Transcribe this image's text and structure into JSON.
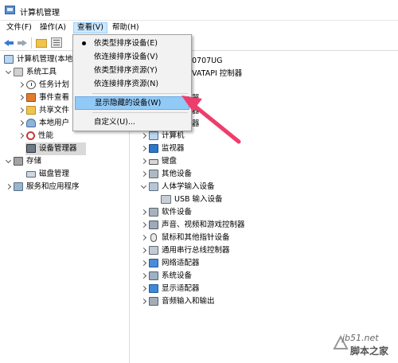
{
  "window": {
    "title": "计算机管理"
  },
  "menubar": [
    {
      "label": "文件(F)"
    },
    {
      "label": "操作(A)"
    },
    {
      "label": "查看(V)"
    },
    {
      "label": "帮助(H)"
    }
  ],
  "view_menu": {
    "items": [
      {
        "label": "依类型排序设备(E)",
        "checked": true
      },
      {
        "label": "依连接排序设备(V)"
      },
      {
        "label": "依类型排序资源(Y)"
      },
      {
        "label": "依连接排序资源(N)"
      },
      {
        "label": "显示隐藏的设备(W)",
        "highlighted": true
      },
      {
        "label": "自定义(U)..."
      }
    ]
  },
  "left_tree": [
    {
      "label": "计算机管理(本地",
      "icon": "computer-icon"
    },
    {
      "label": "系统工具",
      "icon": "tools-icon"
    },
    {
      "label": "任务计划",
      "icon": "clock-icon"
    },
    {
      "label": "事件查看",
      "icon": "event-viewer-icon"
    },
    {
      "label": "共享文件",
      "icon": "shared-folder-icon"
    },
    {
      "label": "本地用户",
      "icon": "users-icon"
    },
    {
      "label": "性能",
      "icon": "performance-icon"
    },
    {
      "label": "设备管理器",
      "icon": "device-manager-icon",
      "selected": true
    },
    {
      "label": "存储",
      "icon": "storage-icon"
    },
    {
      "label": "磁盘管理",
      "icon": "disk-icon"
    },
    {
      "label": "服务和应用程序",
      "icon": "services-icon"
    }
  ],
  "right_tree": {
    "partial_rows": [
      {
        "label": "0707UG"
      },
      {
        "label": "VATAPI 控制器"
      },
      {
        "label": "器"
      },
      {
        "label": "器"
      },
      {
        "label": "器"
      }
    ],
    "rows": [
      {
        "label": "计算机",
        "icon": "computer-icon"
      },
      {
        "label": "监视器",
        "icon": "monitor-icon"
      },
      {
        "label": "键盘",
        "icon": "keyboard-icon"
      },
      {
        "label": "其他设备",
        "icon": "other-device-icon"
      },
      {
        "label": "人体学输入设备",
        "icon": "hid-icon"
      },
      {
        "label": "USB 输入设备",
        "icon": "usb-input-icon"
      },
      {
        "label": "软件设备",
        "icon": "software-device-icon"
      },
      {
        "label": "声音、视频和游戏控制器",
        "icon": "sound-icon"
      },
      {
        "label": "鼠标和其他指针设备",
        "icon": "mouse-icon"
      },
      {
        "label": "通用串行总线控制器",
        "icon": "usb-controller-icon"
      },
      {
        "label": "网络适配器",
        "icon": "network-icon"
      },
      {
        "label": "系统设备",
        "icon": "system-device-icon"
      },
      {
        "label": "显示适配器",
        "icon": "display-adapter-icon"
      },
      {
        "label": "音频输入和输出",
        "icon": "audio-io-icon"
      }
    ]
  },
  "watermark": {
    "line1": "jb51.net",
    "line2": "脚本之家"
  },
  "colors": {
    "highlight": "#91c9f7",
    "arrow": "#ef3d6b",
    "menu_active": "#cce8ff"
  }
}
